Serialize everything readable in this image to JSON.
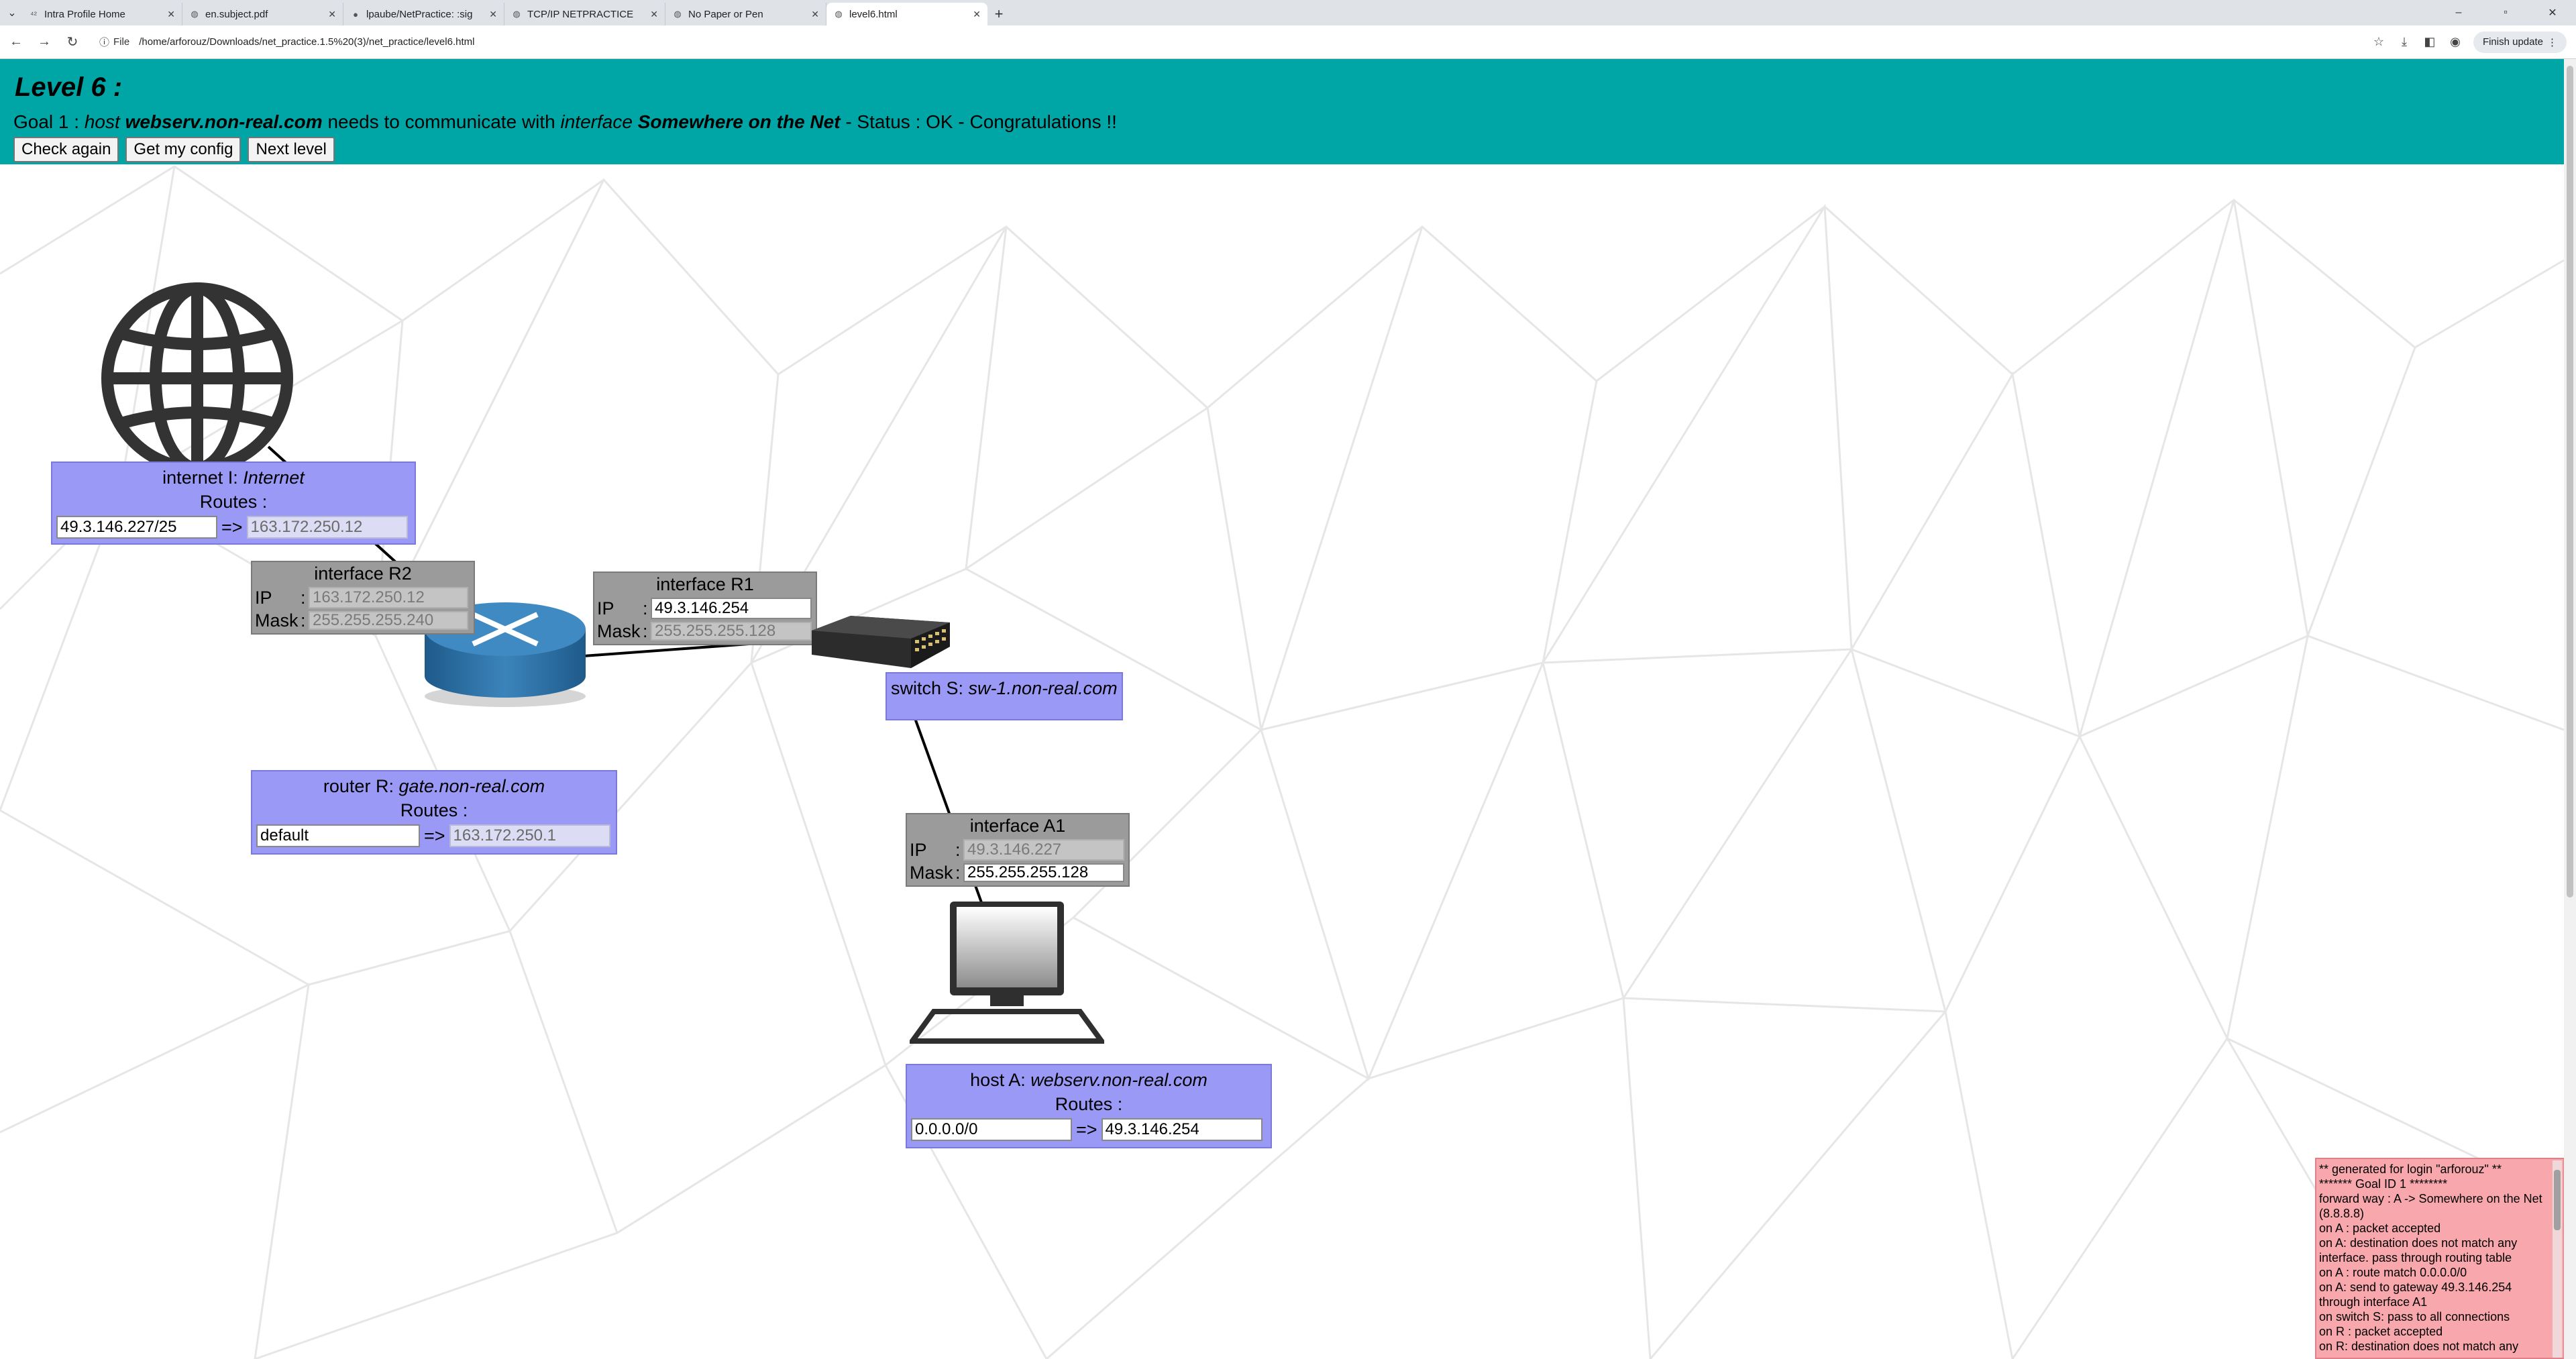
{
  "browser": {
    "tabs": [
      {
        "title": "Intra Profile Home",
        "icon": "42-logo-icon"
      },
      {
        "title": "en.subject.pdf",
        "icon": "globe-icon"
      },
      {
        "title": "lpaube/NetPractice: :sig",
        "icon": "github-icon"
      },
      {
        "title": "TCP/IP NETPRACTICE",
        "icon": "globe-icon"
      },
      {
        "title": "No Paper or Pen",
        "icon": "globe-icon"
      },
      {
        "title": "level6.html",
        "icon": "globe-icon"
      }
    ],
    "url_scheme": "File",
    "url": "/home/arforouz/Downloads/net_practice.1.5%20(3)/net_practice/level6.html",
    "finish_update": "Finish update"
  },
  "header": {
    "level_title": "Level 6 :",
    "goal_prefix": "Goal 1 : ",
    "goal_host_word": "host",
    "goal_host_name": "webserv.non-real.com",
    "goal_middle": " needs to communicate with ",
    "goal_iface_word": "interface",
    "goal_iface_name": "Somewhere on the Net",
    "goal_status": " - Status : OK - Congratulations !!",
    "buttons": {
      "check": "Check again",
      "config": "Get my config",
      "next": "Next level"
    }
  },
  "internet": {
    "title_prefix": "internet I: ",
    "title_name": "Internet",
    "routes_label": "Routes :",
    "route_dest": "49.3.146.227/25",
    "route_arrow": "=>",
    "route_gw": "163.172.250.12"
  },
  "iface_r2": {
    "title": "interface R2",
    "ip_label": "IP",
    "ip": "163.172.250.12",
    "mask_label": "Mask",
    "mask": "255.255.255.240"
  },
  "iface_r1": {
    "title": "interface R1",
    "ip_label": "IP",
    "ip": "49.3.146.254",
    "mask_label": "Mask",
    "mask": "255.255.255.128"
  },
  "router": {
    "title_prefix": "router R: ",
    "title_name": "gate.non-real.com",
    "routes_label": "Routes :",
    "route_dest": "default",
    "route_arrow": "=>",
    "route_gw": "163.172.250.1"
  },
  "switch": {
    "title_prefix": "switch S: ",
    "title_name": "sw-1.non-real.com"
  },
  "iface_a1": {
    "title": "interface A1",
    "ip_label": "IP",
    "ip": "49.3.146.227",
    "mask_label": "Mask",
    "mask": "255.255.255.128"
  },
  "host": {
    "title_prefix": "host A: ",
    "title_name": "webserv.non-real.com",
    "routes_label": "Routes :",
    "route_dest": "0.0.0.0/0",
    "route_arrow": "=>",
    "route_gw": "49.3.146.254"
  },
  "log": {
    "lines": [
      "** generated for login \"arforouz\" **",
      "******* Goal ID 1 ********",
      "forward way : A -> Somewhere on the Net (8.8.8.8)",
      "on A : packet accepted",
      "on A: destination does not match any interface. pass through routing table",
      "on A : route match 0.0.0.0/0",
      "on A: send to gateway 49.3.146.254 through interface A1",
      "on switch S: pass to all connections",
      "on R : packet accepted",
      "on R: destination does not match any"
    ]
  },
  "colors": {
    "header_bg": "#00a6a6",
    "node_box": "#9a9af6",
    "interface_box": "#9b9b9b",
    "log_bg": "#f8a8ac"
  }
}
